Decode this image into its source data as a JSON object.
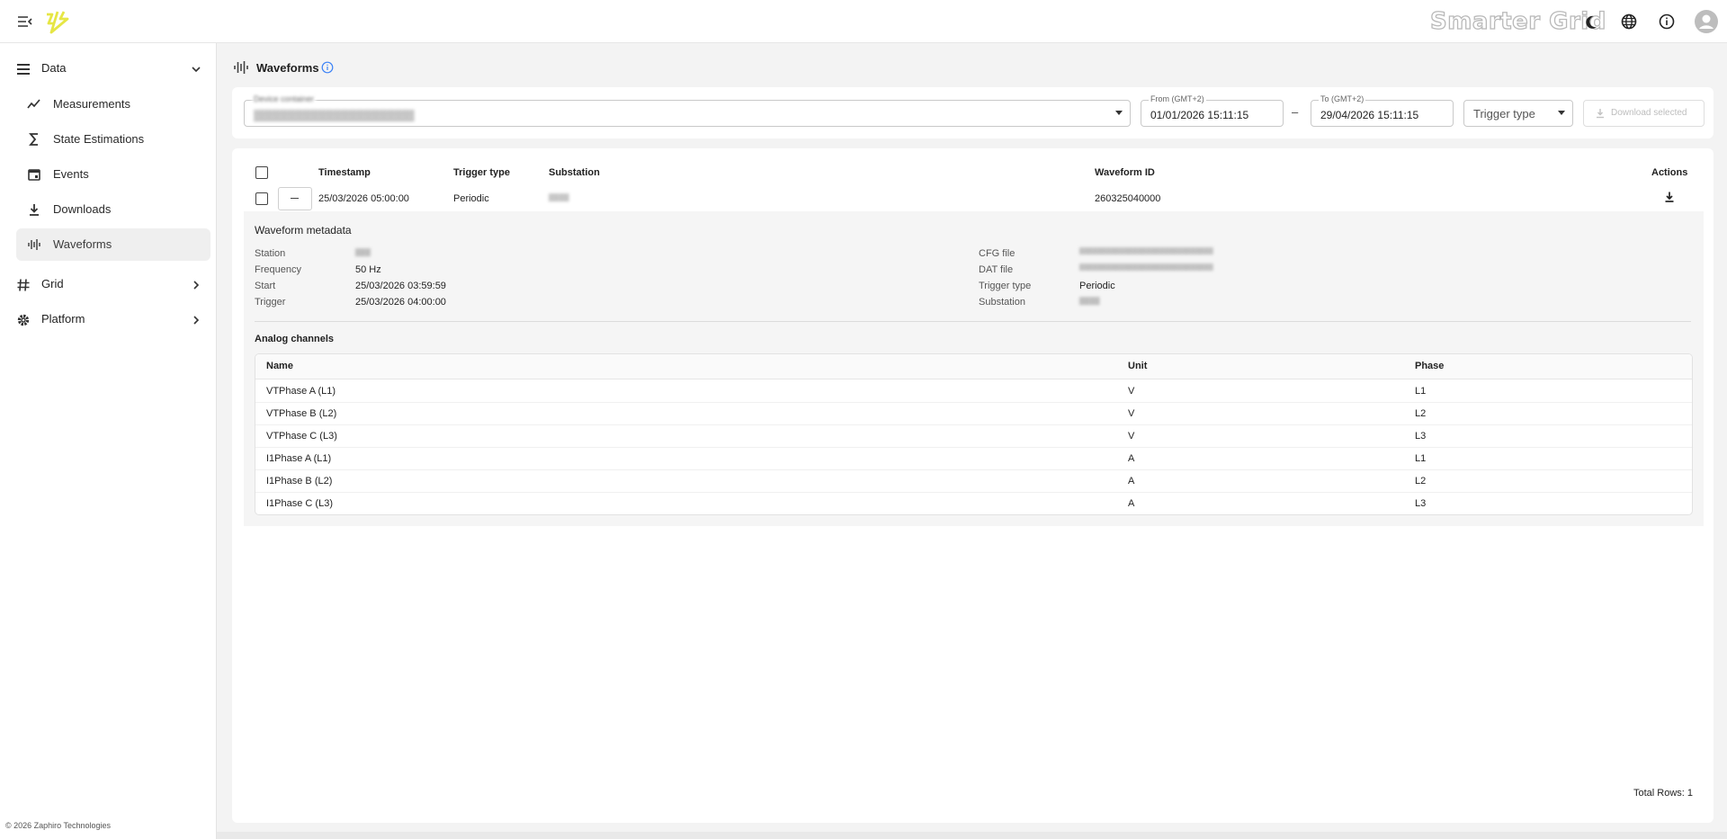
{
  "header": {
    "brand": "Smarter Grid",
    "icons": [
      "menu-collapse-icon",
      "logo-bolt-icon",
      "dark-mode-icon",
      "language-globe-icon",
      "info-icon",
      "account-avatar-icon"
    ],
    "accent_color": "#e6e645"
  },
  "sidebar": {
    "groups": [
      {
        "label": "Data",
        "icon": "list-icon",
        "expanded": true
      },
      {
        "label": "Grid",
        "icon": "hash-icon",
        "expanded": false
      },
      {
        "label": "Platform",
        "icon": "gear-icon",
        "expanded": false
      }
    ],
    "items": [
      {
        "label": "Measurements",
        "icon": "trend-line-icon"
      },
      {
        "label": "State Estimations",
        "icon": "sigma-icon"
      },
      {
        "label": "Events",
        "icon": "calendar-icon"
      },
      {
        "label": "Downloads",
        "icon": "download-icon"
      },
      {
        "label": "Waveforms",
        "icon": "waveform-icon",
        "active": true
      }
    ],
    "footer": "© 2026 Zaphiro Technologies"
  },
  "page": {
    "title": "Waveforms",
    "title_icon": "waveform-icon",
    "help_icon": "info-circle-icon"
  },
  "filters": {
    "device_container_label": "Device container",
    "device_container_value": "▒▒▒▒▒▒▒▒▒▒▒▒▒▒▒▒▒▒▒▒▒",
    "from_label": "From (GMT+2)",
    "from_value": "01/01/2026 15:11:15",
    "range_sep": "–",
    "to_label": "To (GMT+2)",
    "to_value": "29/04/2026 15:11:15",
    "trigger_type_label": "Trigger type",
    "download_label": "Download selected"
  },
  "table": {
    "columns": [
      "Timestamp",
      "Trigger type",
      "Substation",
      "Waveform ID",
      "Actions"
    ],
    "rows": [
      {
        "timestamp": "25/03/2026 05:00:00",
        "trigger_type": "Periodic",
        "substation": "▒▒▒▒",
        "waveform_id": "260325040000"
      }
    ],
    "total_rows": "Total Rows: 1"
  },
  "metadata": {
    "title": "Waveform metadata",
    "left": [
      {
        "label": "Station",
        "value": "▒▒▒"
      },
      {
        "label": "Frequency",
        "value": "50 Hz"
      },
      {
        "label": "Start",
        "value": "25/03/2026 03:59:59"
      },
      {
        "label": "Trigger",
        "value": "25/03/2026 04:00:00"
      }
    ],
    "right": [
      {
        "label": "CFG file",
        "value": "▒▒▒▒▒▒▒▒▒▒▒▒▒▒▒▒▒▒▒▒▒▒▒▒▒▒▒▒▒▒"
      },
      {
        "label": "DAT file",
        "value": "▒▒▒▒▒▒▒▒▒▒▒▒▒▒▒▒▒▒▒▒▒▒▒▒▒▒▒▒▒▒"
      },
      {
        "label": "Trigger type",
        "value": "Periodic"
      },
      {
        "label": "Substation",
        "value": "▒▒▒▒"
      }
    ]
  },
  "channels": {
    "title": "Analog channels",
    "columns": [
      "Name",
      "Unit",
      "Phase"
    ],
    "rows": [
      {
        "name": "VTPhase A (L1)",
        "unit": "V",
        "phase": "L1"
      },
      {
        "name": "VTPhase B (L2)",
        "unit": "V",
        "phase": "L2"
      },
      {
        "name": "VTPhase C (L3)",
        "unit": "V",
        "phase": "L3"
      },
      {
        "name": "I1Phase A (L1)",
        "unit": "A",
        "phase": "L1"
      },
      {
        "name": "I1Phase B (L2)",
        "unit": "A",
        "phase": "L2"
      },
      {
        "name": "I1Phase C (L3)",
        "unit": "A",
        "phase": "L3"
      }
    ]
  }
}
